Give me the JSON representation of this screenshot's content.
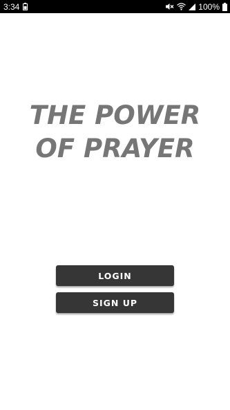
{
  "status_bar": {
    "time": "3:34",
    "battery_percent": "100%",
    "icons": [
      "battery-saver-icon",
      "mute-icon",
      "wifi-icon",
      "signal-icon",
      "battery-icon"
    ]
  },
  "title": {
    "line1": "THE POWER",
    "line2": "OF PRAYER",
    "color": "#767676"
  },
  "buttons": {
    "login_label": "LOGIN",
    "signup_label": "SIGN UP",
    "background": "#363636"
  }
}
